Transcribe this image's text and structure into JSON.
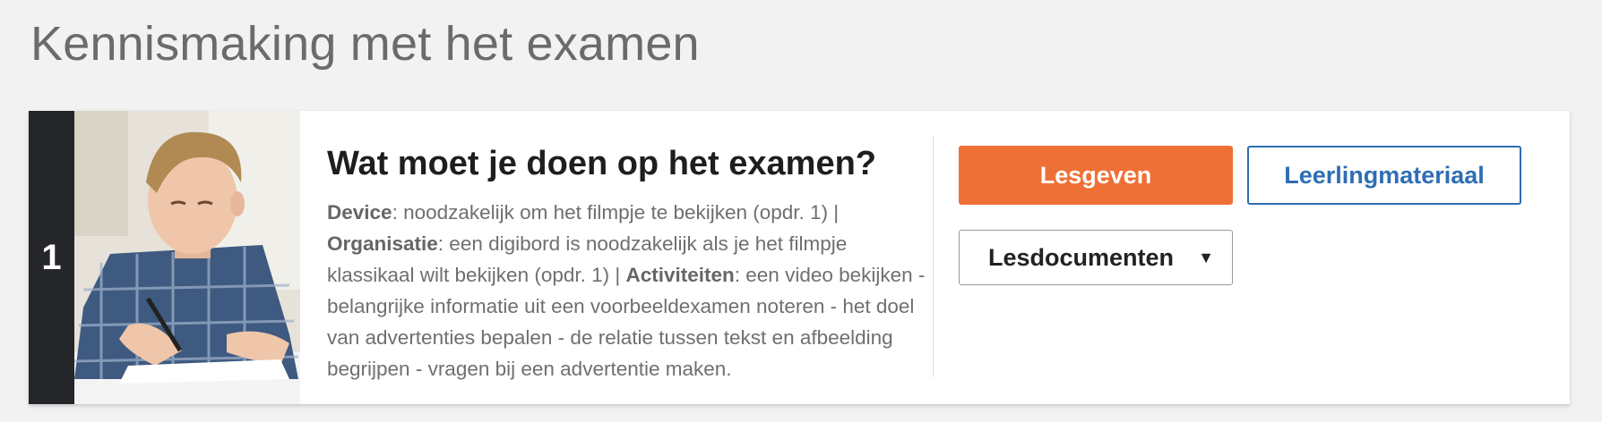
{
  "page": {
    "title": "Kennismaking met het examen"
  },
  "lesson": {
    "number": "1",
    "title": "Wat moet je doen op het examen?",
    "desc": {
      "device_label": "Device",
      "device_text": ": noodzakelijk om het filmpje te bekijken (opdr. 1) |",
      "org_label": "Organisatie",
      "org_text": ": een digibord is noodzakelijk als je het filmpje klassikaal wilt bekijken (opdr. 1) |",
      "act_label": "Activiteiten",
      "act_text": ": een video bekijken - belangrijke informatie uit een voorbeeldexamen noteren - het doel van advertenties bepalen - de relatie tussen tekst en afbeelding begrijpen - vragen bij een advertentie maken."
    }
  },
  "actions": {
    "primary_label": "Lesgeven",
    "secondary_label": "Leerlingmateriaal",
    "dropdown_label": "Lesdocumenten",
    "dropdown_caret": "▼"
  },
  "colors": {
    "accent_orange": "#ef7036",
    "link_blue": "#2f6db5",
    "number_bar": "#24262a"
  },
  "icons": {
    "dropdown": "caret-down-icon"
  }
}
